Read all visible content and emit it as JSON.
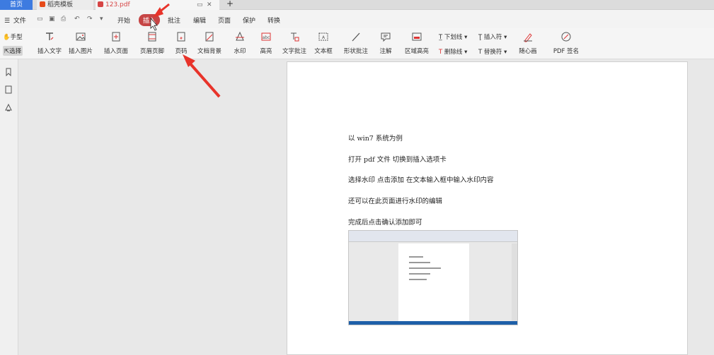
{
  "tabs": {
    "home": "首页",
    "template": "稻壳模板",
    "pdf": "123.pdf",
    "add": "+"
  },
  "menubar": {
    "file_label": "文件",
    "tabs": [
      "开始",
      "插入",
      "批注",
      "编辑",
      "页面",
      "保护",
      "转换"
    ],
    "active_tab": "插入"
  },
  "left_tools": {
    "hand": "手型",
    "select": "选择"
  },
  "ribbon": {
    "insert_text": "插入文字",
    "insert_image": "插入图片",
    "insert_page": "插入页面",
    "header_footer": "页眉页脚",
    "page_number": "页码",
    "doc_background": "文档背景",
    "watermark": "水印",
    "highlight": "高亮",
    "text_comment": "文字批注",
    "text_box": "文本框",
    "shape_comment": "形状批注",
    "note": "注解",
    "area_highlight": "区域高亮",
    "underline": "下划线",
    "strikethrough": "删除线",
    "insert_symbol": "插入符",
    "replace_symbol": "替换符",
    "pen": "随心画",
    "pdf_sign": "PDF 签名"
  },
  "document": {
    "lines": [
      "以 win7 系统为例",
      "打开 pdf 文件    切换到插入选项卡",
      "选择水印      点击添加    在文本输入框中输入水印内容",
      "还可以在此页面进行水印的编辑",
      "完成后点击确认添加即可"
    ]
  },
  "colors": {
    "accent": "#3d7be0",
    "active_tab": "#c64545",
    "annotation_arrow": "#e8332a"
  }
}
